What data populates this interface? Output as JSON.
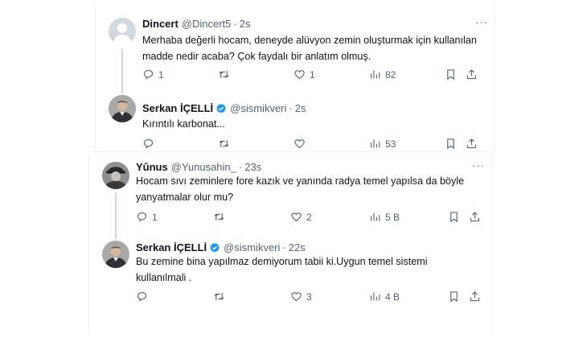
{
  "tweets": [
    {
      "name": "Dincert",
      "handle": "@Dincert5",
      "dot": "·",
      "time": "2s",
      "text_line1": "Merhaba değerli hocam, deneyde alüvyon zemin oluşturmak için kullanılan",
      "text_line2": "madde nedir acaba? Çok faydalı bir anlatım olmuş.",
      "replies": "1",
      "retweets": "",
      "likes": "1",
      "views": "82"
    },
    {
      "name": "Serkan İÇELLİ",
      "handle": "@sismikveri",
      "dot": "·",
      "time": "2s",
      "text_line1": "Kırıntılı karbonat...",
      "replies": "",
      "retweets": "",
      "likes": "",
      "views": "53"
    },
    {
      "name": "Yûnus",
      "handle": "@Yunusahin_",
      "dot": "·",
      "time": "23s",
      "text_line1": "Hocam sıvı zeminlere fore kazık ve yanında radya temel yapılsa da böyle",
      "text_line2": "yanyatmalar olur mu?",
      "replies": "1",
      "retweets": "",
      "likes": "2",
      "views": "5 B"
    },
    {
      "name": "Serkan İÇELLİ",
      "handle": "@sismikveri",
      "dot": "·",
      "time": "22s",
      "text_line1": "Bu zemine bina yapılmaz demiyorum tabii ki.Uygun temel sistemi",
      "text_line2": "kullanılmali .",
      "replies": "",
      "retweets": "",
      "likes": "3",
      "views": "4 B"
    }
  ],
  "more_glyph": "···",
  "colors": {
    "verified": "#1d9bf0",
    "muted": "#536471",
    "thread_line": "#cfd9de",
    "divider": "#eff3f4"
  },
  "icons": [
    "reply-icon",
    "retweet-icon",
    "like-icon",
    "views-icon",
    "bookmark-icon",
    "share-icon",
    "verified-badge-icon",
    "more-icon"
  ]
}
